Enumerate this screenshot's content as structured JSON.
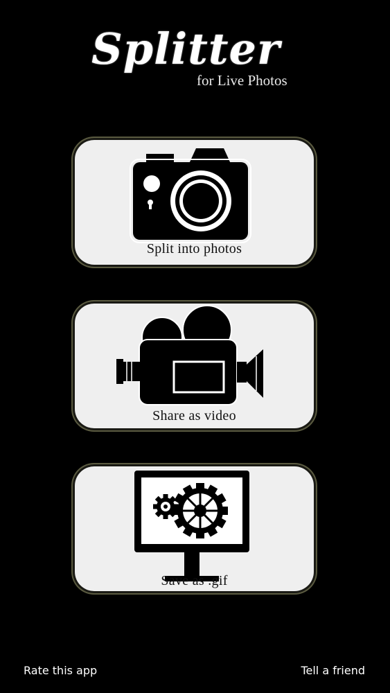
{
  "app": {
    "title": "Splitter",
    "subtitle": "for Live Photos"
  },
  "actions": [
    {
      "label": "Split into photos",
      "icon": "photo-camera-icon"
    },
    {
      "label": "Share as video",
      "icon": "video-camera-icon"
    },
    {
      "label": "Save as .gif",
      "icon": "monitor-gears-icon"
    }
  ],
  "footer": {
    "rate_label": "Rate this app",
    "tell_label": "Tell a friend"
  },
  "colors": {
    "background": "#000000",
    "card": "#efefef",
    "icon": "#000000"
  }
}
